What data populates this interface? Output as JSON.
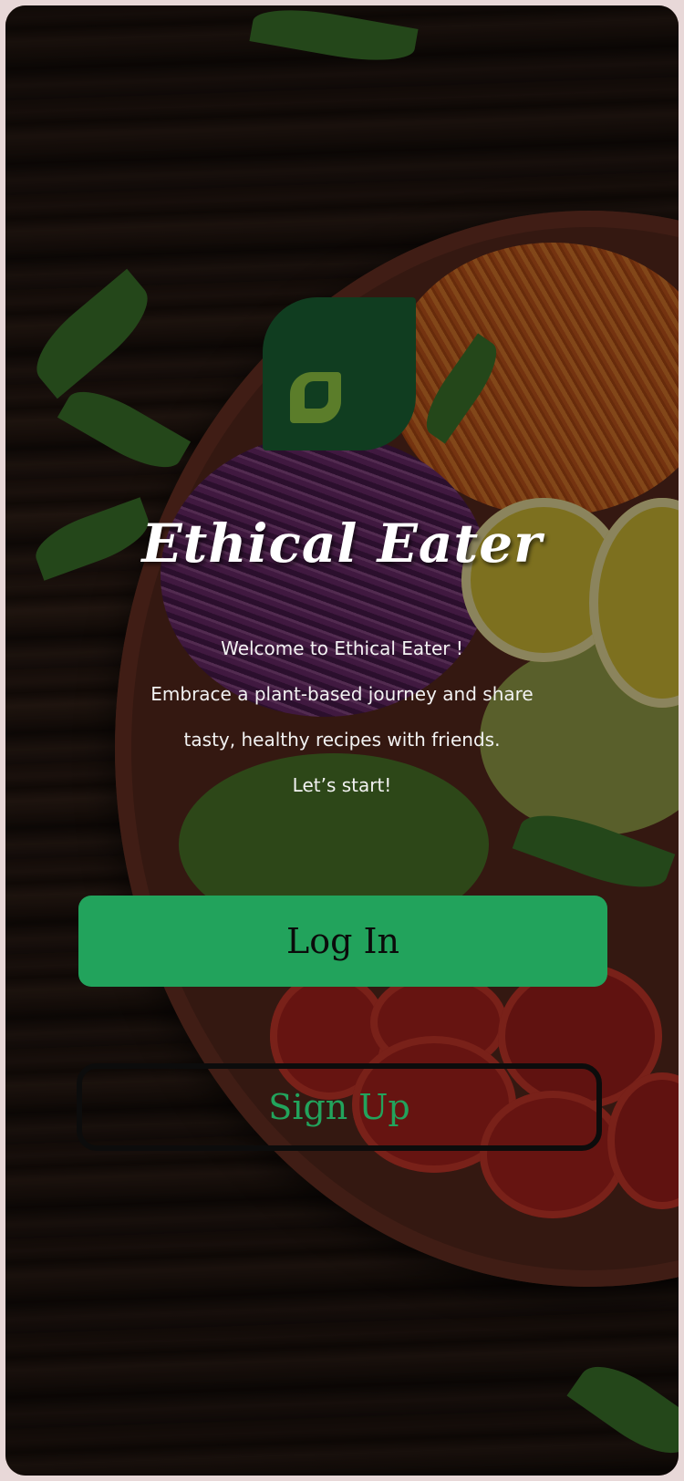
{
  "app": {
    "title": "Ethical Eater",
    "logo_icon": "leaf-icon",
    "logo_color": "#103d20"
  },
  "welcome": {
    "lines": [
      "Welcome to Ethical Eater !",
      "Embrace a plant-based journey and share",
      "tasty, healthy recipes with friends.",
      "Let’s start!"
    ]
  },
  "actions": {
    "login_label": "Log In",
    "signup_label": "Sign Up",
    "accent_color": "#22a35c"
  }
}
